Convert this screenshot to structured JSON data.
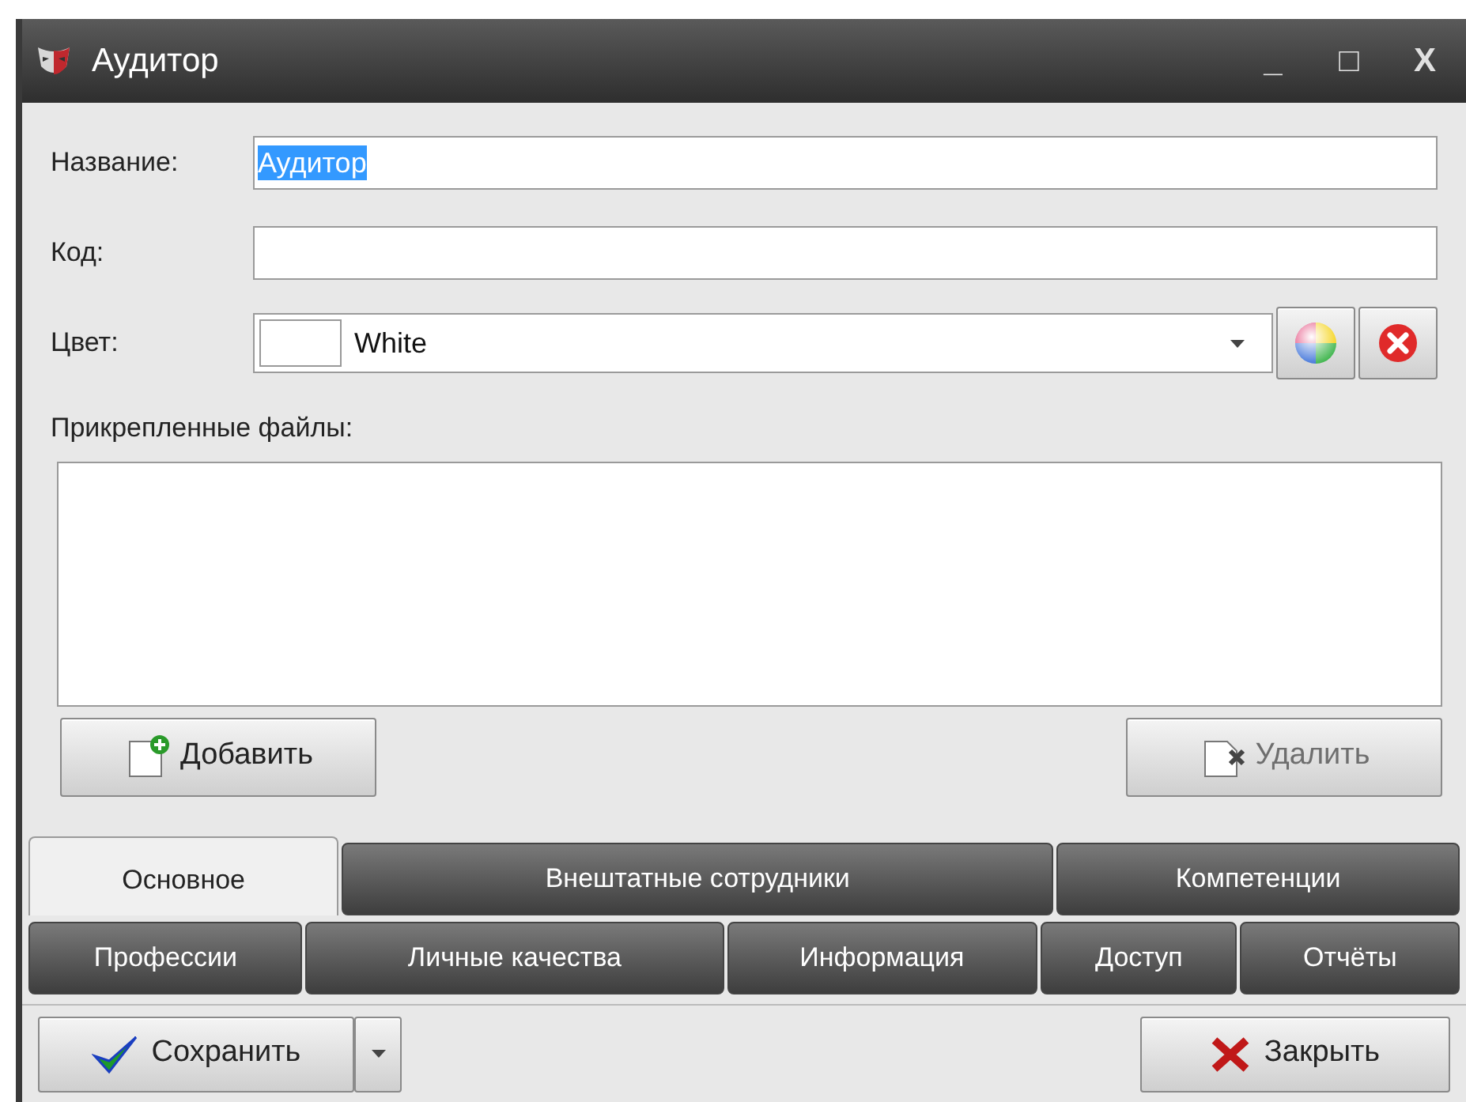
{
  "window": {
    "title": "Аудитор",
    "controls": [
      "_",
      "□",
      "X"
    ]
  },
  "fields": [
    {
      "label": "Название:",
      "kind": "text",
      "value": "Аудитор",
      "text_selected": true
    },
    {
      "label": "Код:",
      "kind": "text"
    },
    {
      "label": "Цвет:",
      "kind": "color",
      "value": "White",
      "color": "#ffffff"
    }
  ],
  "attachments": {
    "label": "Прикрепленные файлы:"
  },
  "file_buttons": [
    {
      "label": "Добавить",
      "kind": "add",
      "disabled": false
    },
    {
      "label": "Удалить",
      "kind": "delete",
      "disabled": true
    }
  ],
  "tab_rows": [
    [
      {
        "label": "Основное",
        "selected": true
      },
      {
        "label": "Внештатные сотрудники",
        "selected": false
      },
      {
        "label": "Компетенции",
        "selected": false
      }
    ],
    [
      {
        "label": "Профессии",
        "selected": false
      },
      {
        "label": "Личные качества",
        "selected": false
      },
      {
        "label": "Информация",
        "selected": false
      },
      {
        "label": "Доступ",
        "selected": false
      },
      {
        "label": "Отчёты",
        "selected": false
      }
    ]
  ],
  "footer_buttons": [
    {
      "label": "Сохранить",
      "kind": "save"
    },
    {
      "label": "Закрыть",
      "kind": "close"
    }
  ]
}
